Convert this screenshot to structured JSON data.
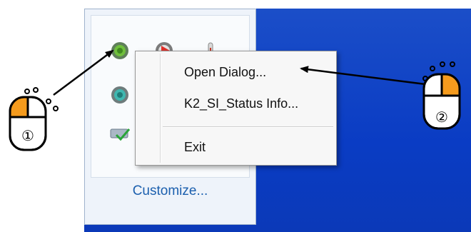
{
  "menu": {
    "items": [
      {
        "label": "Open Dialog..."
      },
      {
        "label": "K2_SI_Status Info..."
      },
      {
        "label": "Exit"
      }
    ]
  },
  "tray": {
    "customize_label": "Customize...",
    "icons": [
      "green-gear-icon",
      "red-play-icon",
      "thermometer-icon",
      "teal-gear-icon",
      "check-drive-icon"
    ]
  },
  "markers": {
    "left_number": "①",
    "right_number": "②"
  },
  "colors": {
    "desktop": "#0a3cc4",
    "accent_orange": "#f59b1d",
    "link_blue": "#1b5fae"
  }
}
